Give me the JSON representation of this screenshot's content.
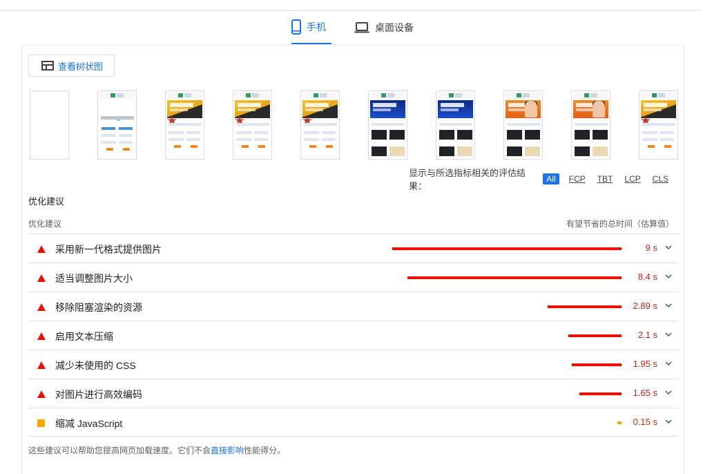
{
  "tabs": [
    {
      "label": "手机",
      "icon": "smartphone-icon",
      "active": true
    },
    {
      "label": "桌面设备",
      "icon": "laptop-icon",
      "active": false
    }
  ],
  "tree_button": {
    "label": "查看树状图",
    "icon": "treemap-icon"
  },
  "filmstrip": {
    "frames": [
      {
        "kind": "blank"
      },
      {
        "kind": "loading"
      },
      {
        "kind": "yellow"
      },
      {
        "kind": "yellow"
      },
      {
        "kind": "yellow"
      },
      {
        "kind": "blue"
      },
      {
        "kind": "blue"
      },
      {
        "kind": "orange"
      },
      {
        "kind": "orange"
      },
      {
        "kind": "yellow"
      }
    ]
  },
  "filter": {
    "label": "显示与所选指标相关的评估结果：",
    "chips": [
      "All",
      "FCP",
      "TBT",
      "LCP",
      "CLS"
    ],
    "active_chip": "All"
  },
  "section_title": "优化建议",
  "columns": {
    "left": "优化建议",
    "right": "有望节省的总时间（估算值）"
  },
  "opportunities": [
    {
      "title": "采用新一代格式提供图片",
      "value": "9 s",
      "seconds": 9,
      "severity": "fail"
    },
    {
      "title": "适当调整图片大小",
      "value": "8.4 s",
      "seconds": 8.4,
      "severity": "fail"
    },
    {
      "title": "移除阻塞渲染的资源",
      "value": "2.89 s",
      "seconds": 2.89,
      "severity": "fail"
    },
    {
      "title": "启用文本压缩",
      "value": "2.1 s",
      "seconds": 2.1,
      "severity": "fail"
    },
    {
      "title": "减少未使用的 CSS",
      "value": "1.95 s",
      "seconds": 1.95,
      "severity": "fail"
    },
    {
      "title": "对图片进行高效编码",
      "value": "1.65 s",
      "seconds": 1.65,
      "severity": "fail"
    },
    {
      "title": "缩减 JavaScript",
      "value": "0.15 s",
      "seconds": 0.15,
      "severity": "average"
    }
  ],
  "colors": {
    "fail": "#eb0f00",
    "fail_text": "#c7221f",
    "average": "#ffa400",
    "average_text": "#c33300",
    "accent": "#1a73e8"
  },
  "footnote": {
    "before": "这些建议可以帮助您提高网页加载速度。它们不会",
    "link": "直接影响",
    "after": "性能得分。"
  }
}
